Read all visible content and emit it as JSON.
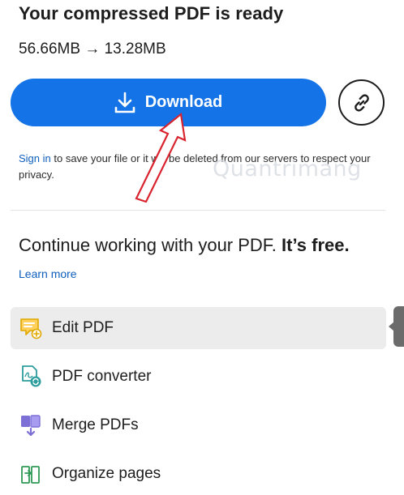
{
  "header": {
    "title": "Your compressed PDF is ready",
    "size_change": "56.66MB → 13.28MB"
  },
  "actions": {
    "download_label": "Download",
    "download_icon": "download-icon",
    "link_icon": "link-icon"
  },
  "signin": {
    "link_text": "Sign in",
    "message": " to save your file or it will be deleted from our servers to respect your privacy."
  },
  "watermark": "Quantrimang",
  "continue": {
    "text": "Continue working with your PDF.",
    "emphasis": " It’s free.",
    "learn_more": "Learn more"
  },
  "tools": [
    {
      "label": "Edit PDF",
      "icon": "edit-pdf-icon"
    },
    {
      "label": "PDF converter",
      "icon": "pdf-converter-icon"
    },
    {
      "label": "Merge PDFs",
      "icon": "merge-pdfs-icon"
    },
    {
      "label": "Organize pages",
      "icon": "organize-pages-icon"
    }
  ],
  "colors": {
    "accent": "#1473e6",
    "link": "#0f5fbd",
    "active_row": "#ececec",
    "annotation_arrow": "#d9232e"
  }
}
